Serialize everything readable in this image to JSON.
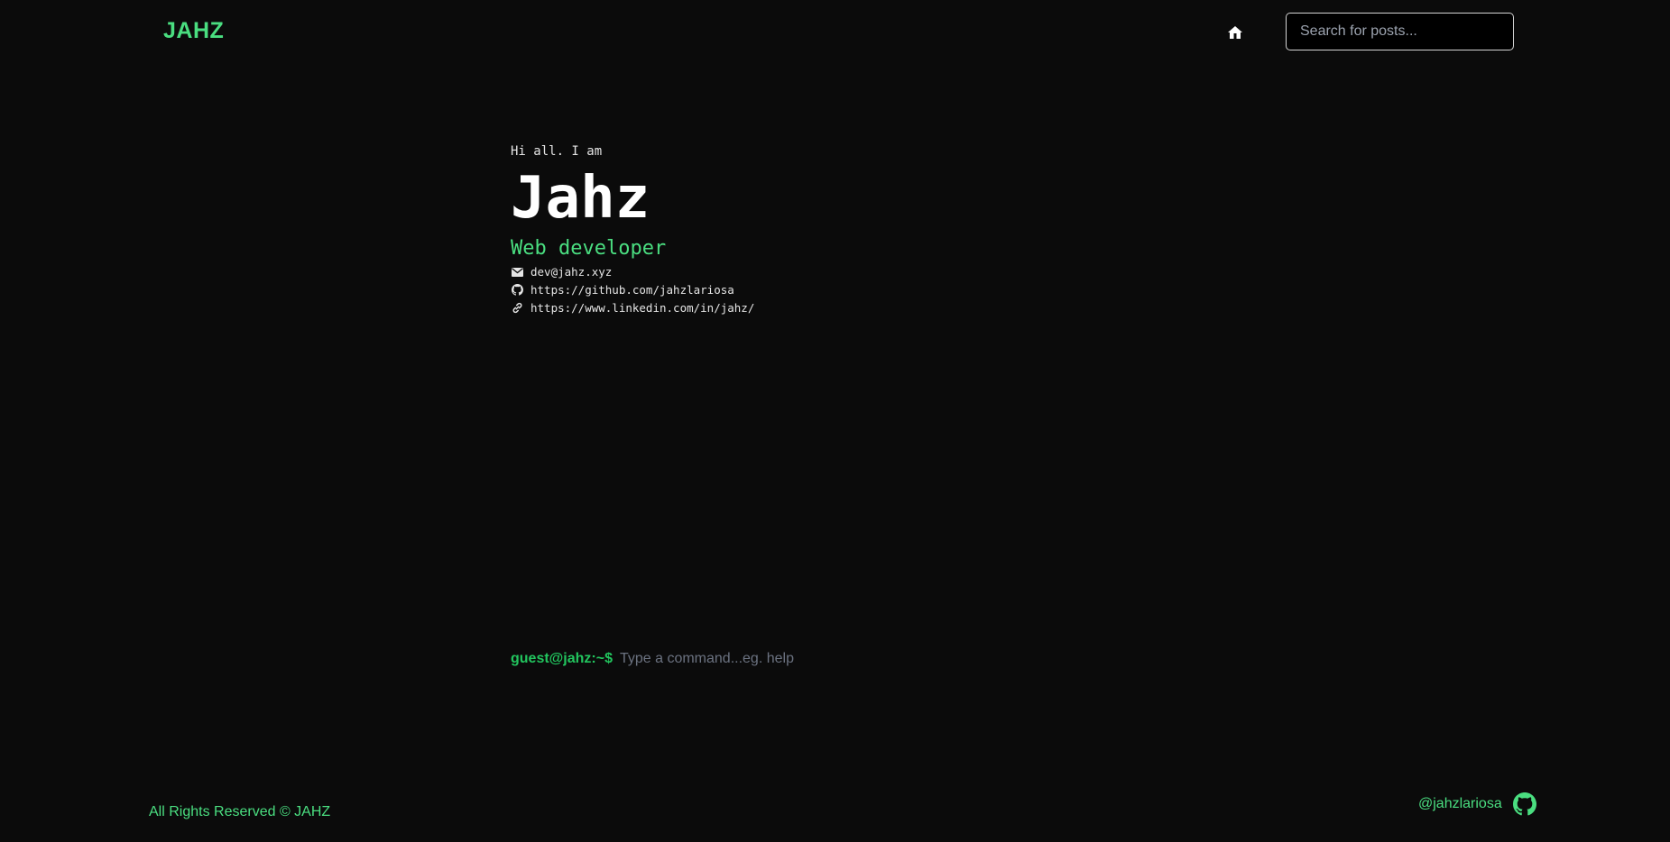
{
  "header": {
    "brand": "JAHZ",
    "home_icon": "home-icon",
    "search": {
      "placeholder": "Search for posts...",
      "value": ""
    }
  },
  "hero": {
    "greeting": "Hi all. I am",
    "name": "Jahz",
    "role": "Web developer",
    "contacts": [
      {
        "icon": "mail-icon",
        "text": "dev@jahz.xyz"
      },
      {
        "icon": "github-icon",
        "text": "https://github.com/jahzlariosa"
      },
      {
        "icon": "link-icon",
        "text": "https://www.linkedin.com/in/jahz/"
      }
    ]
  },
  "terminal": {
    "prompt": "guest@jahz:~$",
    "placeholder": "Type a command...eg. help"
  },
  "footer": {
    "copyright": "All Rights Reserved © JAHZ",
    "handle": "@jahzlariosa",
    "handle_icon": "github-icon"
  },
  "colors": {
    "background": "#0b0b0b",
    "accent": "#4ade80",
    "text": "#e5e5e5"
  }
}
